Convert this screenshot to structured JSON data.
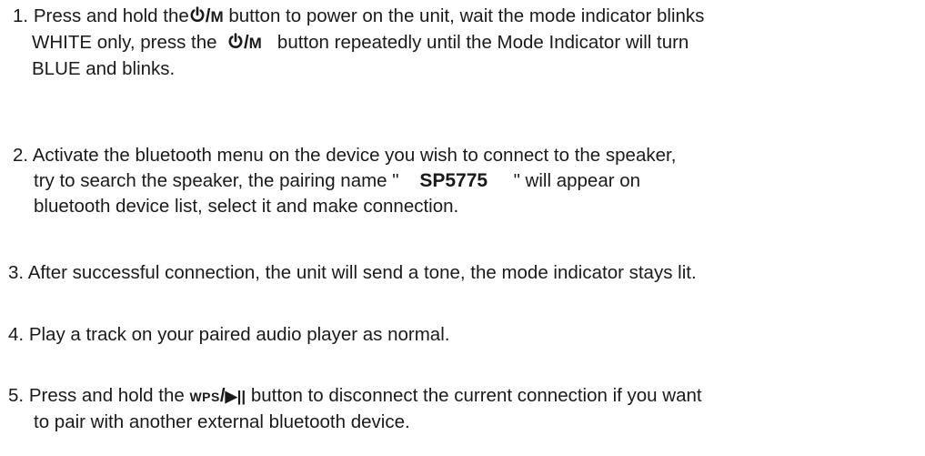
{
  "steps": [
    {
      "number": "1.",
      "line1_a": "Press and hold the",
      "line1_b": "button to power on the unit, wait the mode indicator blinks",
      "line2_a": "WHITE only,  press the",
      "line2_b": "button repeatedly until the Mode Indicator will turn",
      "line3": "BLUE and blinks."
    },
    {
      "number": "2.",
      "line1": "Activate the bluetooth menu on the device you wish to connect to the speaker,",
      "line2_a": "try to search the speaker,  the pairing name \"",
      "pairing_name": "SP5775",
      "line2_b": "\" will appear on",
      "line3": "bluetooth device list, select it and make connection."
    },
    {
      "number": "3.",
      "line1": "After successful connection, the unit will send a tone, the mode indicator stays lit."
    },
    {
      "number": "4.",
      "line1": "Play a track on your paired audio player as normal."
    },
    {
      "number": "5.",
      "line1_a": "Press and hold the",
      "line1_b": "button to disconnect the current connection if you want",
      "line2": "to pair with another external bluetooth device."
    }
  ],
  "symbols": {
    "mode_button_letter": "M",
    "wps_button_text": "WPS",
    "play_pause_glyph": "▶||"
  }
}
